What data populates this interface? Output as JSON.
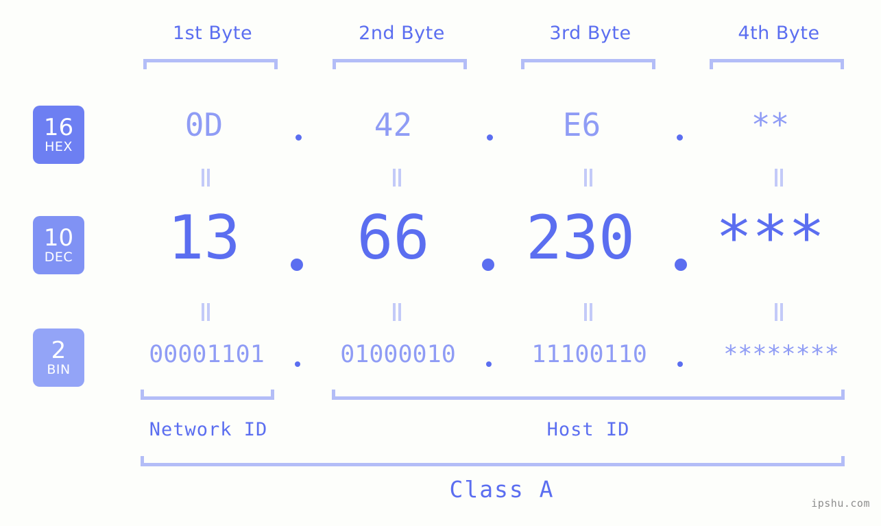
{
  "meta": {
    "watermark": "ipshu.com",
    "background_color": "#fdfefb",
    "accent_color": "#5b6ef0",
    "accent_light_color": "#8f9cf5",
    "bracket_color": "#b3bdf7",
    "equals_color": "#c3caf8"
  },
  "byte_headers": [
    {
      "label": "1st Byte"
    },
    {
      "label": "2nd Byte"
    },
    {
      "label": "3rd Byte"
    },
    {
      "label": "4th Byte"
    }
  ],
  "bases": [
    {
      "number": "16",
      "name": "HEX",
      "color": "#6d7ff2"
    },
    {
      "number": "10",
      "name": "DEC",
      "color": "#8092f4"
    },
    {
      "number": "2",
      "name": "BIN",
      "color": "#93a4f7"
    }
  ],
  "rows": {
    "hex": {
      "base_number": "16",
      "base_name": "HEX",
      "values": [
        "0D",
        "42",
        "E6",
        "**"
      ],
      "separator": "."
    },
    "dec": {
      "base_number": "10",
      "base_name": "DEC",
      "values": [
        "13",
        "66",
        "230",
        "***"
      ],
      "separator": "."
    },
    "bin": {
      "base_number": "2",
      "base_name": "BIN",
      "values": [
        "00001101",
        "01000010",
        "11100110",
        "********"
      ],
      "separator": "."
    }
  },
  "equals_marks": {
    "glyph": "=",
    "count_per_row": 4,
    "rows": 2
  },
  "id_sections": [
    {
      "label": "Network ID"
    },
    {
      "label": "Host ID"
    }
  ],
  "class_section": {
    "label": "Class A"
  }
}
